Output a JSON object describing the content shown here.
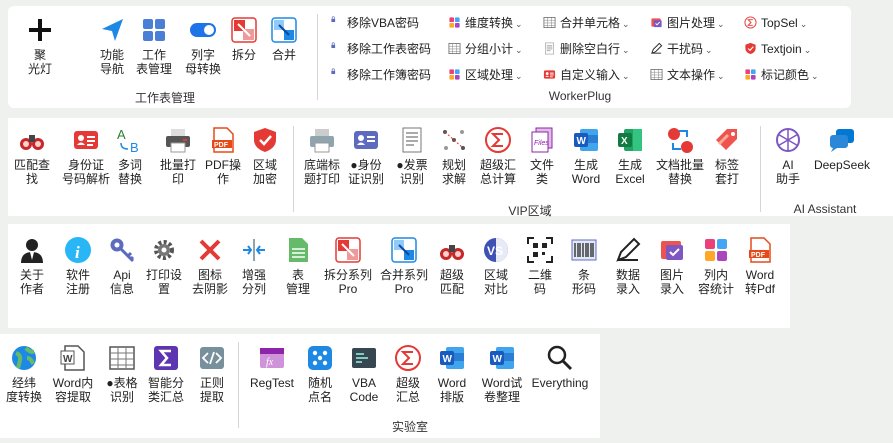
{
  "ribbon1": {
    "group1_label": "工作表管理",
    "group2_label": "WorkerPlug",
    "big_buttons": [
      {
        "label": "聚\n光灯",
        "icon": "plus-icon"
      },
      {
        "label": "功能\n导航",
        "icon": "cursor-arrow-icon"
      },
      {
        "label": "工作\n表管理",
        "icon": "sheet-grid-icon"
      },
      {
        "label": "列字\n母转换",
        "icon": "toggle-icon"
      },
      {
        "label": "拆分",
        "icon": "split-icon"
      },
      {
        "label": "合并",
        "icon": "merge-icon"
      }
    ],
    "small_col1": [
      "移除VBA密码",
      "移除工作表密码",
      "移除工作簿密码"
    ],
    "small_col2": [
      "维度转换",
      "分组小计",
      "区域处理"
    ],
    "small_col3": [
      "合并单元格",
      "删除空白行",
      "自定义输入"
    ],
    "small_col4": [
      "图片处理",
      "干扰码",
      "文本操作"
    ],
    "small_col5": [
      "TopSel",
      "Textjoin",
      "标记颜色"
    ]
  },
  "ribbon2": {
    "group1_label": "VIP区域",
    "group2_label": "AI Assistant",
    "buttons_a": [
      {
        "label": "匹配查\n找",
        "icon": "binoculars-icon"
      },
      {
        "label": "身份证\n号码解析",
        "icon": "id-card-icon"
      },
      {
        "label": "多词\n替换",
        "icon": "ab-replace-icon"
      },
      {
        "label": "批量打\n印",
        "icon": "printer-icon"
      },
      {
        "label": "PDF操\n作",
        "icon": "pdf-icon"
      },
      {
        "label": "区域\n加密",
        "icon": "shield-icon"
      }
    ],
    "buttons_b": [
      {
        "label": "底端标\n题打印",
        "icon": "printer-gray-icon"
      },
      {
        "label": "●身份\n证识别",
        "icon": "id-card-purple-icon"
      },
      {
        "label": "●发票\n识别",
        "icon": "invoice-icon"
      },
      {
        "label": "规划\n求解",
        "icon": "dots-solver-icon"
      },
      {
        "label": "超级汇\n总计算",
        "icon": "sigma-icon"
      },
      {
        "label": "文件\n类",
        "icon": "files-icon"
      },
      {
        "label": "生成\nWord",
        "icon": "word-icon"
      },
      {
        "label": "生成\nExcel",
        "icon": "excel-icon"
      },
      {
        "label": "文档批量\n替换",
        "icon": "doc-replace-icon"
      },
      {
        "label": "标签\n套打",
        "icon": "tag-icon"
      }
    ],
    "buttons_ai": [
      {
        "label": "AI\n助手",
        "icon": "ai-knot-icon"
      },
      {
        "label": "DeepSeek",
        "icon": "chat-bubble-icon"
      }
    ]
  },
  "ribbon3": {
    "buttons": [
      {
        "label": "关于\n作者",
        "icon": "person-icon"
      },
      {
        "label": "软件\n注册",
        "icon": "info-icon"
      },
      {
        "label": "Api\n信息",
        "icon": "key-icon"
      },
      {
        "label": "打印设\n置",
        "icon": "gear-icon"
      },
      {
        "label": "图标\n去阴影",
        "icon": "x-icon"
      },
      {
        "label": "增强\n分列",
        "icon": "split-column-icon"
      },
      {
        "label": "表\n管理",
        "icon": "sheet-green-icon"
      },
      {
        "label": "拆分系列\nPro",
        "icon": "split-icon"
      },
      {
        "label": "合并系列\nPro",
        "icon": "merge-icon"
      },
      {
        "label": "超级\n匹配",
        "icon": "binoculars-icon"
      },
      {
        "label": "区域\n对比",
        "icon": "vs-icon"
      },
      {
        "label": "二维\n码",
        "icon": "qrcode-icon"
      },
      {
        "label": "条\n形码",
        "icon": "barcode-icon"
      },
      {
        "label": "数据\n录入",
        "icon": "pen-icon"
      },
      {
        "label": "图片\n录入",
        "icon": "image-check-icon"
      },
      {
        "label": "列内\n容统计",
        "icon": "tiles-icon"
      },
      {
        "label": "Word\n转Pdf",
        "icon": "pdf-icon"
      }
    ]
  },
  "ribbon4": {
    "group_label": "实验室",
    "buttons_a": [
      {
        "label": "经纬\n度转换",
        "icon": "globe-icon"
      },
      {
        "label": "Word内\n容提取",
        "icon": "word-outline-icon"
      },
      {
        "label": "●表格\n识别",
        "icon": "table-icon"
      },
      {
        "label": "智能分\n类汇总",
        "icon": "sigma-purple-icon"
      },
      {
        "label": "正则\n提取",
        "icon": "code-icon"
      }
    ],
    "buttons_b": [
      {
        "label": "RegTest",
        "icon": "fx-icon"
      },
      {
        "label": "随机\n点名",
        "icon": "dice-icon"
      },
      {
        "label": "VBA\nCode",
        "icon": "vba-icon"
      },
      {
        "label": "超级\n汇总",
        "icon": "sigma-icon"
      },
      {
        "label": "Word\n排版",
        "icon": "word-icon"
      },
      {
        "label": "Word试\n卷整理",
        "icon": "word-icon"
      },
      {
        "label": "Everything",
        "icon": "magnifier-icon"
      }
    ]
  },
  "colors": {
    "accent_blue": "#1e88e5",
    "red": "#e53935",
    "green": "#2e7d32",
    "word": "#2b579a",
    "excel": "#217346",
    "purple": "#7e57c2"
  }
}
